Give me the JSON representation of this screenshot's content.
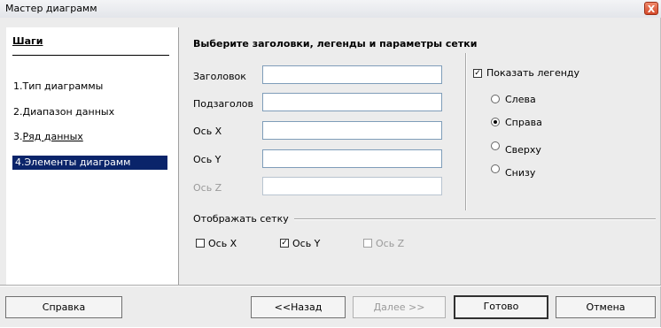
{
  "window": {
    "title": "Мастер диаграмм",
    "close_glyph": "X"
  },
  "steps": {
    "title": "Шаги",
    "items": [
      {
        "num": "1.",
        "label": "Тип диаграммы"
      },
      {
        "num": "2.",
        "label": "Диапазон данных"
      },
      {
        "num": "3.",
        "label": "Ряд данных"
      },
      {
        "num": "4.",
        "label": "Элементы диаграмм"
      }
    ]
  },
  "main": {
    "header": "Выберите заголовки, легенды и параметры сетки",
    "fields": [
      {
        "label": "Заголовок",
        "value": ""
      },
      {
        "label": "Подзаголов",
        "value": ""
      },
      {
        "label": "Ось X",
        "value": ""
      },
      {
        "label": "Ось Y",
        "value": ""
      },
      {
        "label": "Ось Z",
        "value": "",
        "disabled": true
      }
    ],
    "legend": {
      "show_label": "Показать легенду",
      "checked": true,
      "options": [
        {
          "label": "Слева",
          "selected": false
        },
        {
          "label": "Справа",
          "selected": true
        },
        {
          "label": "Сверху",
          "selected": false
        },
        {
          "label": "Снизу",
          "selected": false
        }
      ]
    },
    "grid": {
      "title": "Отображать сетку",
      "x_label": "Ось X",
      "x_checked": false,
      "y_label": "Ось Y",
      "y_checked": true,
      "z_label": "Ось Z",
      "z_checked": false
    }
  },
  "buttons": {
    "help": "Справка",
    "back": "<<Назад",
    "next": "Далее >>",
    "finish": "Готово",
    "cancel": "Отмена"
  }
}
